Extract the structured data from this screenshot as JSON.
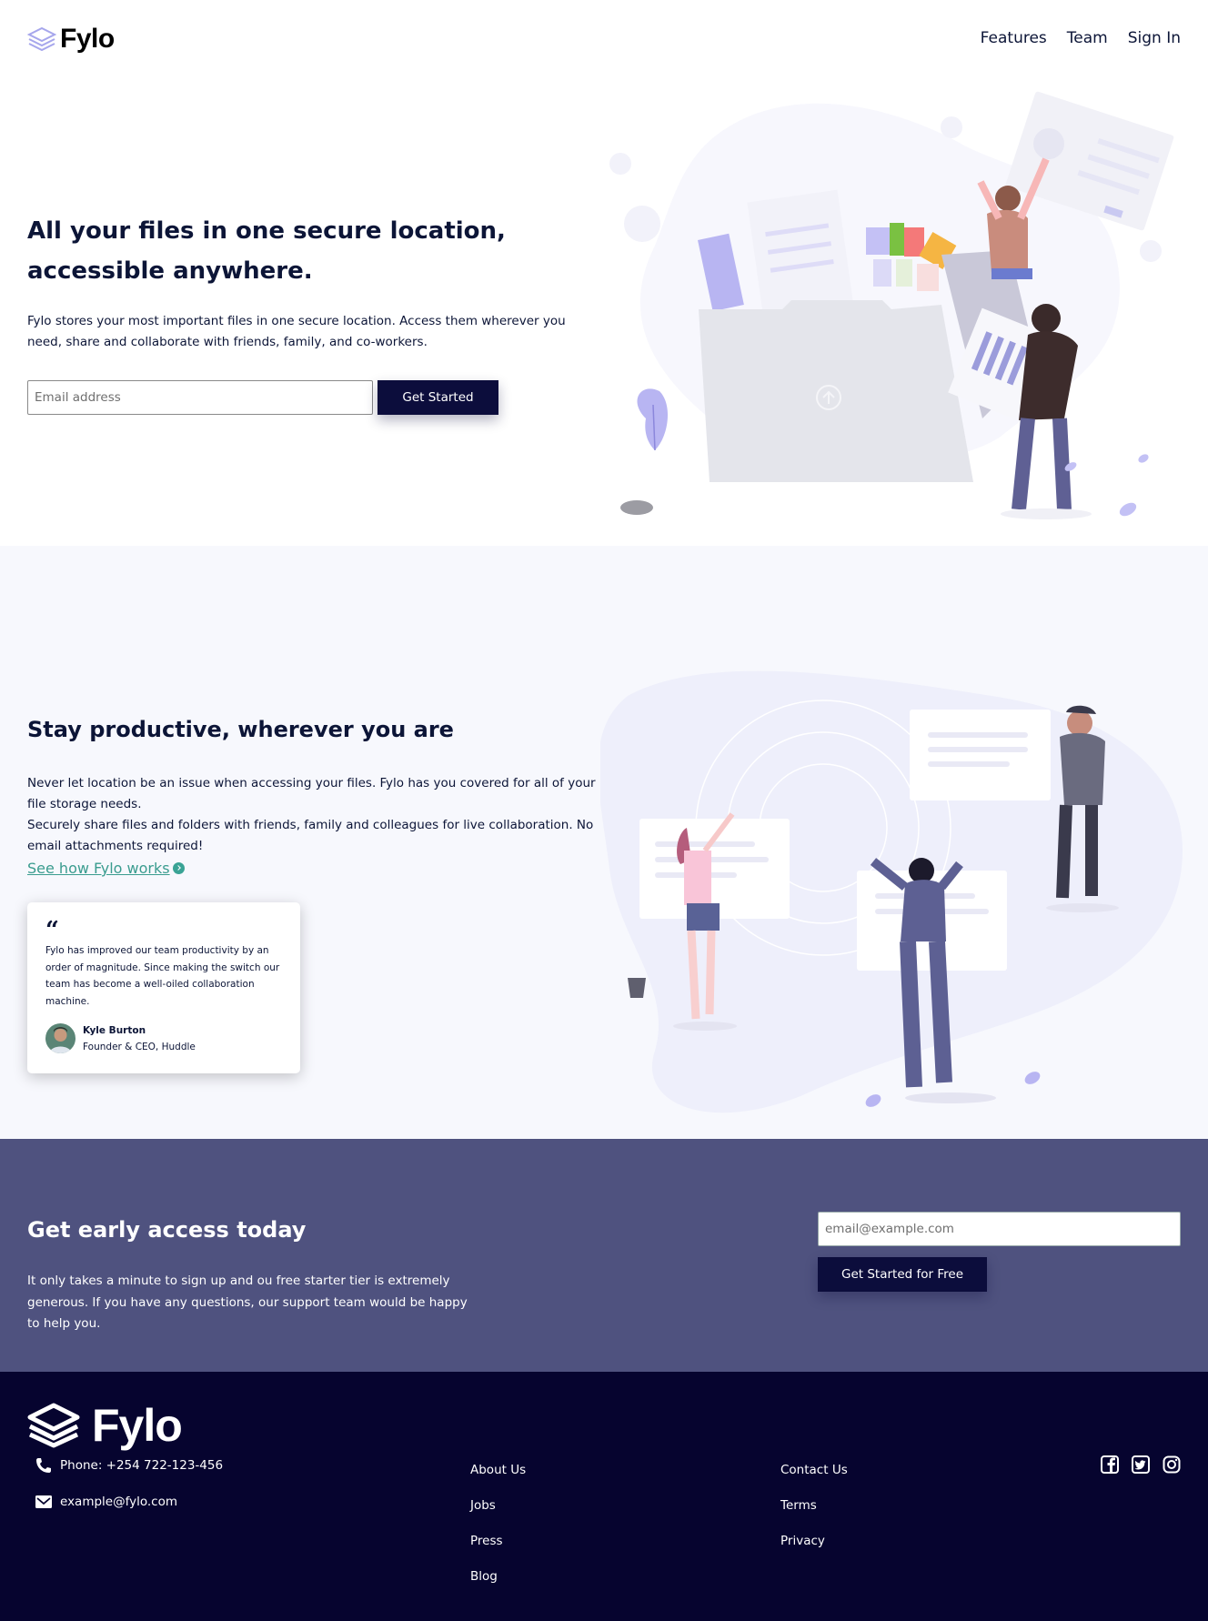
{
  "header": {
    "logo_text": "Fylo",
    "nav": [
      "Features",
      "Team",
      "Sign In"
    ]
  },
  "hero": {
    "title": "All your files in one secure location, accessible anywhere.",
    "text": "Fylo stores your most important files in one secure location. Access them wherever you need, share and collaborate with friends, family, and co-workers.",
    "email_placeholder": "Email address",
    "button_label": "Get Started"
  },
  "productive": {
    "title": "Stay productive, wherever you are",
    "paragraph1": "Never let location be an issue when accessing your files. Fylo has you covered for all of your file storage needs.",
    "paragraph2": "Securely share files and folders with friends, family and colleagues for live collaboration. No email attachments required!",
    "link_text": "See how Fylo works ",
    "testimonial": {
      "quote_mark": "“",
      "text": "Fylo has improved our team productivity by an order of magnitude. Since making the switch our team has become a well-oiled collaboration machine.",
      "name": "Kyle Burton",
      "role": "Founder & CEO, Huddle"
    }
  },
  "early_access": {
    "title": "Get early access today",
    "text": "It only takes a minute to sign up and ou free starter tier is extremely generous. If you have any questions, our support team would be happy to help you.",
    "email_placeholder": "email@example.com",
    "button_label": "Get Started for Free"
  },
  "footer": {
    "logo_text": "Fylo",
    "phone": "Phone: +254 722-123-456",
    "email": "example@fylo.com",
    "links_col1": [
      "About Us",
      "Jobs",
      "Press",
      "Blog"
    ],
    "links_col2": [
      "Contact Us",
      "Terms",
      "Privacy"
    ],
    "socials": [
      "facebook-icon",
      "twitter-icon",
      "instagram-icon"
    ]
  },
  "colors": {
    "navy": "#0c1537",
    "button": "#0c0d3c",
    "early_bg": "#4f527f",
    "footer_bg": "#06042f",
    "link": "#3a9c8f"
  }
}
